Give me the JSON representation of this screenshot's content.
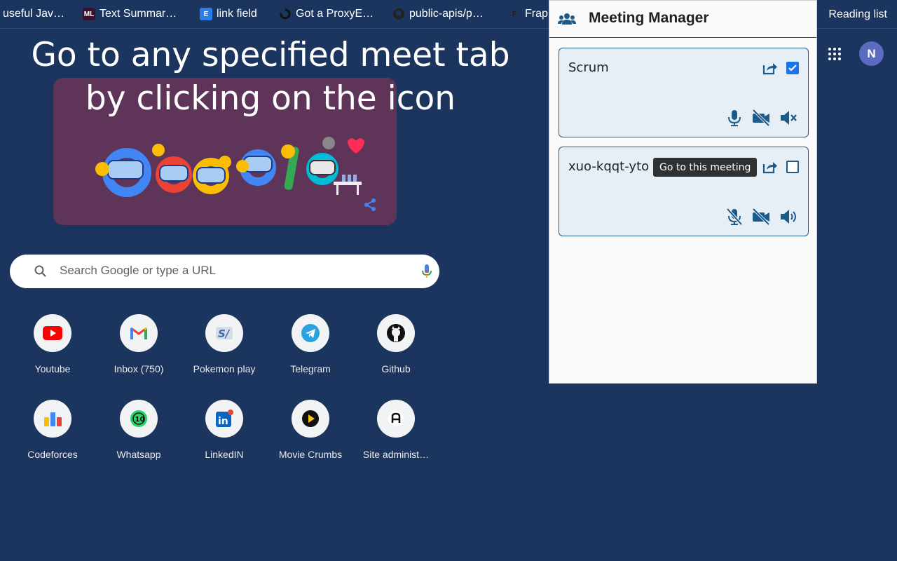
{
  "bookmarks": [
    {
      "label": "useful Jav…",
      "icon": "none"
    },
    {
      "label": "Text Summar…",
      "icon": "ml-icon"
    },
    {
      "label": "link field",
      "icon": "e-icon"
    },
    {
      "label": "Got a ProxyE…",
      "icon": "spinner-icon"
    },
    {
      "label": "public-apis/p…",
      "icon": "github-icon"
    },
    {
      "label": "Frap",
      "icon": "frappe-icon"
    }
  ],
  "reading_list": "Reading list",
  "caption": {
    "line1": "Go to any specified meet tab",
    "line2": "by clicking on the icon"
  },
  "search": {
    "placeholder": "Search Google or type a URL"
  },
  "shortcuts": [
    {
      "label": "Youtube"
    },
    {
      "label": "Inbox (750)"
    },
    {
      "label": "Pokemon play"
    },
    {
      "label": "Telegram"
    },
    {
      "label": "Github"
    },
    {
      "label": "Codeforces"
    },
    {
      "label": "Whatsapp"
    },
    {
      "label": "LinkedIN"
    },
    {
      "label": "Movie Crumbs"
    },
    {
      "label": "Site administ…"
    }
  ],
  "avatar_letter": "N",
  "popup": {
    "title": "Meeting Manager",
    "meetings": [
      {
        "name": "Scrum",
        "checked": true,
        "mic": "on",
        "camera": "off",
        "speaker": "muted"
      },
      {
        "name": "xuo-kqqt-yto",
        "checked": false,
        "mic": "off",
        "camera": "off",
        "speaker": "on",
        "tooltip": "Go to this meeting"
      }
    ]
  },
  "colors": {
    "background": "#1c355e",
    "popup_accent": "#1c5a8a",
    "checkbox_checked": "#1a73e8"
  }
}
